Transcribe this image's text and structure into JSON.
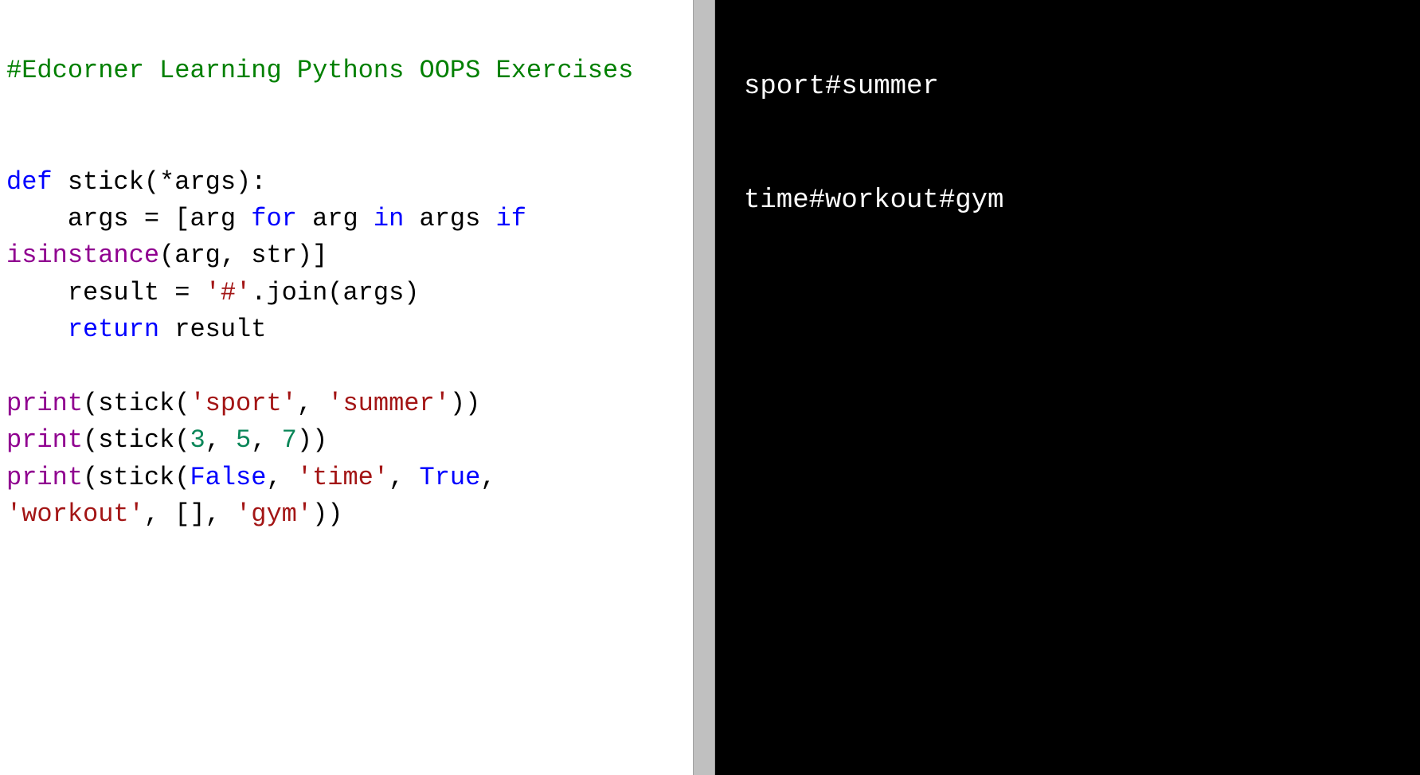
{
  "code": {
    "comment": "#Edcorner Learning Pythons OOPS Exercises",
    "line2_def": "def",
    "line2_rest": " stick(*args):",
    "line3_pre": "    args = [arg ",
    "line3_for": "for",
    "line3_mid": " arg ",
    "line3_in": "in",
    "line3_mid2": " args ",
    "line3_if": "if",
    "line4_isinstance": "isinstance",
    "line4_rest": "(arg, str)]",
    "line5_pre": "    result = ",
    "line5_str": "'#'",
    "line5_rest": ".join(args)",
    "line6_return": "    return",
    "line6_rest": " result",
    "line8_print": "print",
    "line8_a": "(stick(",
    "line8_s1": "'sport'",
    "line8_c": ", ",
    "line8_s2": "'summer'",
    "line8_end": "))",
    "line9_print": "print",
    "line9_a": "(stick(",
    "line9_n1": "3",
    "line9_c1": ", ",
    "line9_n2": "5",
    "line9_c2": ", ",
    "line9_n3": "7",
    "line9_end": "))",
    "line10_print": "print",
    "line10_a": "(stick(",
    "line10_false": "False",
    "line10_c1": ", ",
    "line10_s1": "'time'",
    "line10_c2": ", ",
    "line10_true": "True",
    "line10_c3": ",",
    "line11_s1": "'workout'",
    "line11_c1": ", [], ",
    "line11_s2": "'gym'",
    "line11_end": "))"
  },
  "output": {
    "line1": "sport#summer",
    "line2": "",
    "line3": "time#workout#gym"
  }
}
